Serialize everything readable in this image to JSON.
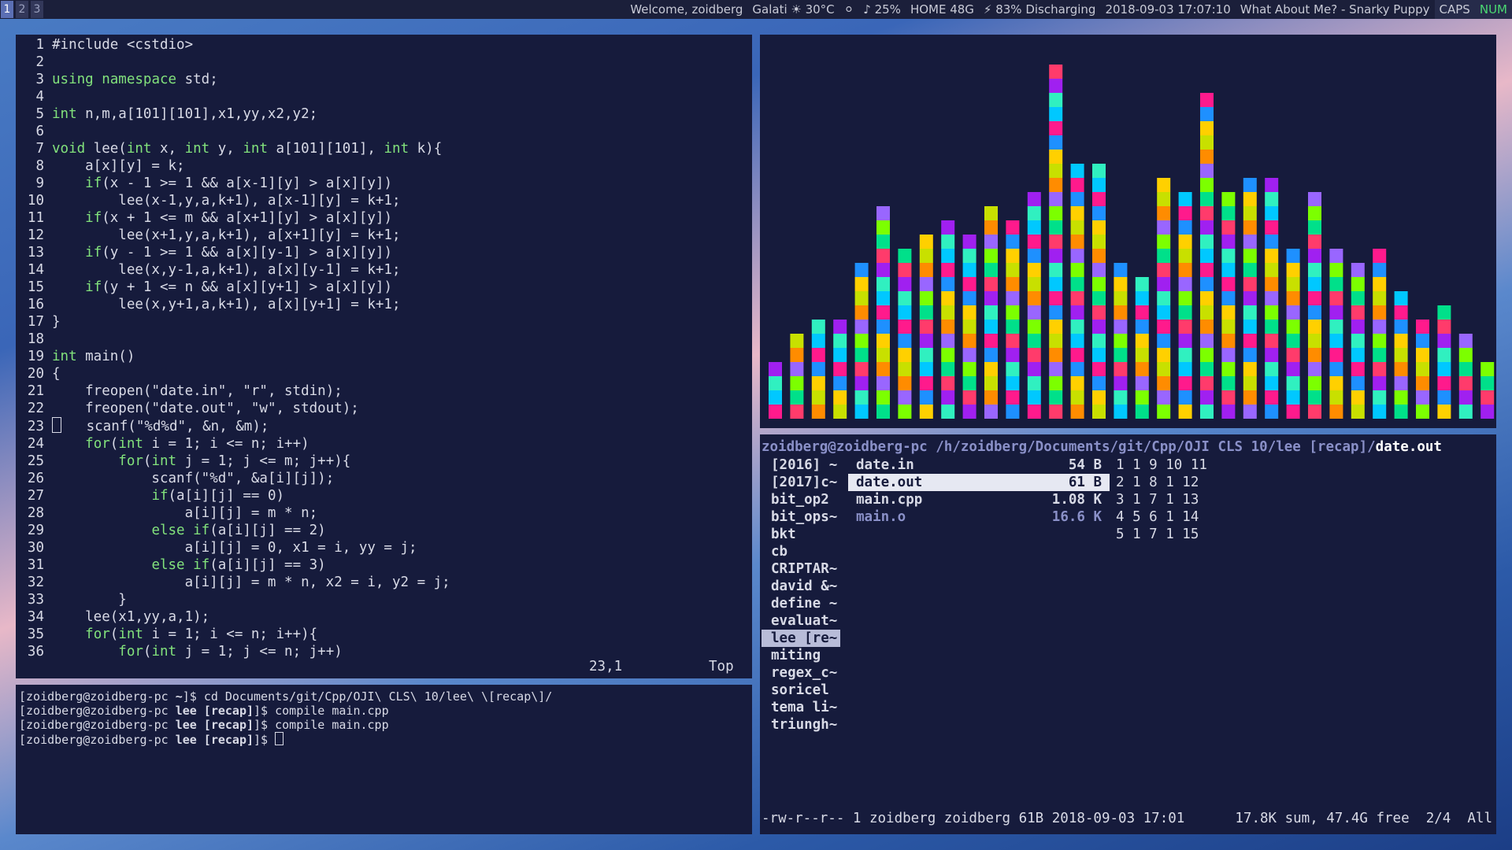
{
  "workspaces": [
    "1",
    "2",
    "3"
  ],
  "statusbar": {
    "welcome": "Welcome, zoidberg",
    "weather": "Galati ☀ 30°C",
    "moon": "⚪",
    "volume": "♪ 25%",
    "home": "HOME 48G",
    "battery": "⚡  83% Discharging",
    "datetime": "2018-09-03 17:07:10",
    "song": "What About Me? - Snarky Puppy",
    "caps": "CAPS",
    "num": "NUM"
  },
  "editor": {
    "lines": [
      "#include <cstdio>",
      "",
      "using namespace std;",
      "",
      "int n,m,a[101][101],x1,yy,x2,y2;",
      "",
      "void lee(int x, int y, int a[101][101], int k){",
      "    a[x][y] = k;",
      "    if(x - 1 >= 1 && a[x-1][y] > a[x][y])",
      "        lee(x-1,y,a,k+1), a[x-1][y] = k+1;",
      "    if(x + 1 <= m && a[x+1][y] > a[x][y])",
      "        lee(x+1,y,a,k+1), a[x+1][y] = k+1;",
      "    if(y - 1 >= 1 && a[x][y-1] > a[x][y])",
      "        lee(x,y-1,a,k+1), a[x][y-1] = k+1;",
      "    if(y + 1 <= n && a[x][y+1] > a[x][y])",
      "        lee(x,y+1,a,k+1), a[x][y+1] = k+1;",
      "}",
      "",
      "int main()",
      "{",
      "    freopen(\"date.in\", \"r\", stdin);",
      "    freopen(\"date.out\", \"w\", stdout);",
      "    scanf(\"%d%d\", &n, &m);",
      "    for(int i = 1; i <= n; i++)",
      "        for(int j = 1; j <= m; j++){",
      "            scanf(\"%d\", &a[i][j]);",
      "            if(a[i][j] == 0)",
      "                a[i][j] = m * n;",
      "            else if(a[i][j] == 2)",
      "                a[i][j] = 0, x1 = i, yy = j;",
      "            else if(a[i][j] == 3)",
      "                a[i][j] = m * n, x2 = i, y2 = j;",
      "        }",
      "    lee(x1,yy,a,1);",
      "    for(int i = 1; i <= n; i++){",
      "        for(int j = 1; j <= n; j++)"
    ],
    "cursor_line": 23,
    "position": "23,1",
    "scroll": "Top"
  },
  "terminal": [
    {
      "prompt_user": "[zoidberg@zoidberg-pc ",
      "dir": "~",
      "end": "]$ ",
      "cmd": "cd Documents/git/Cpp/OJI\\ CLS\\ 10/lee\\ \\[recap\\]/"
    },
    {
      "prompt_user": "[zoidberg@zoidberg-pc ",
      "dir": "lee [recap]",
      "end": "]$ ",
      "cmd": "compile main.cpp"
    },
    {
      "prompt_user": "[zoidberg@zoidberg-pc ",
      "dir": "lee [recap]",
      "end": "]$ ",
      "cmd": "compile main.cpp"
    },
    {
      "prompt_user": "[zoidberg@zoidberg-pc ",
      "dir": "lee [recap]",
      "end": "]$ ",
      "cmd": ""
    }
  ],
  "visualizer": {
    "bar_levels": [
      0.15,
      0.23,
      0.26,
      0.27,
      0.43,
      0.59,
      0.48,
      0.52,
      0.54,
      0.5,
      0.61,
      0.56,
      0.62,
      1.0,
      0.73,
      0.72,
      0.42,
      0.4,
      0.66,
      0.63,
      0.91,
      0.64,
      0.68,
      0.68,
      0.49,
      0.63,
      0.46,
      0.45,
      0.47,
      0.35,
      0.27,
      0.31,
      0.24,
      0.17
    ],
    "palette": [
      "#ff1a8c",
      "#00e08a",
      "#ffd000",
      "#a020f0",
      "#ff8c00",
      "#00c8ff",
      "#7cff00",
      "#1e90ff",
      "#ff3b6b",
      "#c8e000",
      "#30f0c0",
      "#9966ff"
    ]
  },
  "ranger": {
    "path_user": "zoidberg@zoidberg-pc",
    "path_dir": " /h/zoidberg/Documents/git/Cpp/OJI CLS 10/lee [recap]/",
    "path_file": "date.out",
    "dirs": [
      "[2016] ~",
      "[2017]c~",
      "bit_op2",
      "bit_ops~",
      "bkt",
      "cb",
      "CRIPTAR~",
      "david &~",
      "define ~",
      "evaluat~",
      "lee [re~",
      "miting",
      "regex_c~",
      "soricel",
      "tema li~",
      "triungh~"
    ],
    "dirs_selected": 10,
    "files": [
      {
        "name": "date.in",
        "size": "54 B"
      },
      {
        "name": "date.out",
        "size": "61 B"
      },
      {
        "name": "main.cpp",
        "size": "1.08 K"
      },
      {
        "name": "main.o",
        "size": "16.6 K"
      }
    ],
    "files_selected": 1,
    "preview": [
      "1 1 9 10 11",
      "2 1 8 1 12",
      "3 1 7 1 13",
      "4 5 6 1 14",
      "5 1 7 1 15"
    ],
    "status_left": "-rw-r--r-- 1 zoidberg zoidberg 61B 2018-09-03 17:01",
    "status_right": "17.8K sum, 47.4G free  2/4  All"
  }
}
